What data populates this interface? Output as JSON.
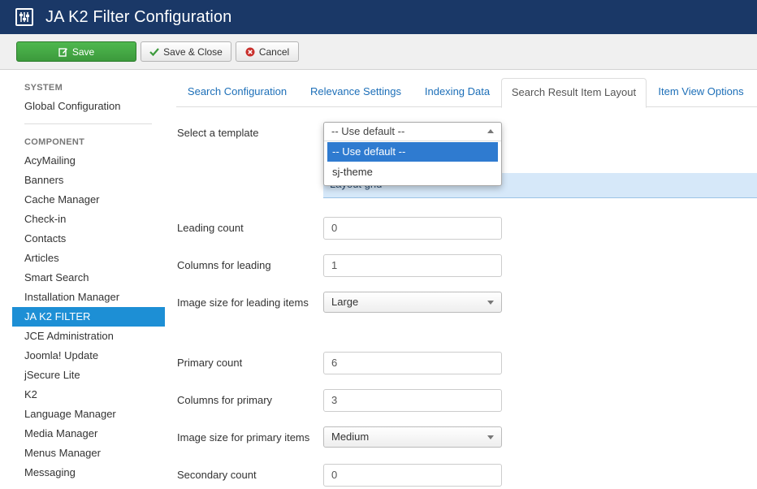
{
  "header": {
    "title": "JA K2 Filter Configuration",
    "icon": "sliders-icon"
  },
  "toolbar": {
    "save_label": "Save",
    "save_close_label": "Save & Close",
    "cancel_label": "Cancel"
  },
  "sidebar": {
    "system_heading": "SYSTEM",
    "system_items": [
      "Global Configuration"
    ],
    "component_heading": "COMPONENT",
    "component_items": [
      "AcyMailing",
      "Banners",
      "Cache Manager",
      "Check-in",
      "Contacts",
      "Articles",
      "Smart Search",
      "Installation Manager",
      "JA K2 FILTER",
      "JCE Administration",
      "Joomla! Update",
      "jSecure Lite",
      "K2",
      "Language Manager",
      "Media Manager",
      "Menus Manager",
      "Messaging"
    ],
    "active_item": "JA K2 FILTER",
    "active_color": "#1d8fd5"
  },
  "tabs": [
    {
      "label": "Search Configuration",
      "active": false
    },
    {
      "label": "Relevance Settings",
      "active": false
    },
    {
      "label": "Indexing Data",
      "active": false
    },
    {
      "label": "Search Result Item Layout",
      "active": true
    },
    {
      "label": "Item View Options",
      "active": false
    }
  ],
  "form": {
    "template": {
      "label": "Select a template",
      "selected": "-- Use default --",
      "options": [
        "-- Use default --",
        "sj-theme"
      ],
      "highlighted": "-- Use default --"
    },
    "layout_strip_text": "Layout grid",
    "leading_count": {
      "label": "Leading count",
      "value": "0"
    },
    "columns_leading": {
      "label": "Columns for leading",
      "value": "1"
    },
    "image_leading": {
      "label": "Image size for leading items",
      "value": "Large"
    },
    "primary_count": {
      "label": "Primary count",
      "value": "6"
    },
    "columns_primary": {
      "label": "Columns for primary",
      "value": "3"
    },
    "image_primary": {
      "label": "Image size for primary items",
      "value": "Medium"
    },
    "secondary_count": {
      "label": "Secondary count",
      "value": "0"
    }
  },
  "colors": {
    "header_bg": "#1a3867",
    "save_green": "#46a946",
    "link_blue": "#1d6fb8",
    "highlight_blue": "#2f7bd0"
  }
}
